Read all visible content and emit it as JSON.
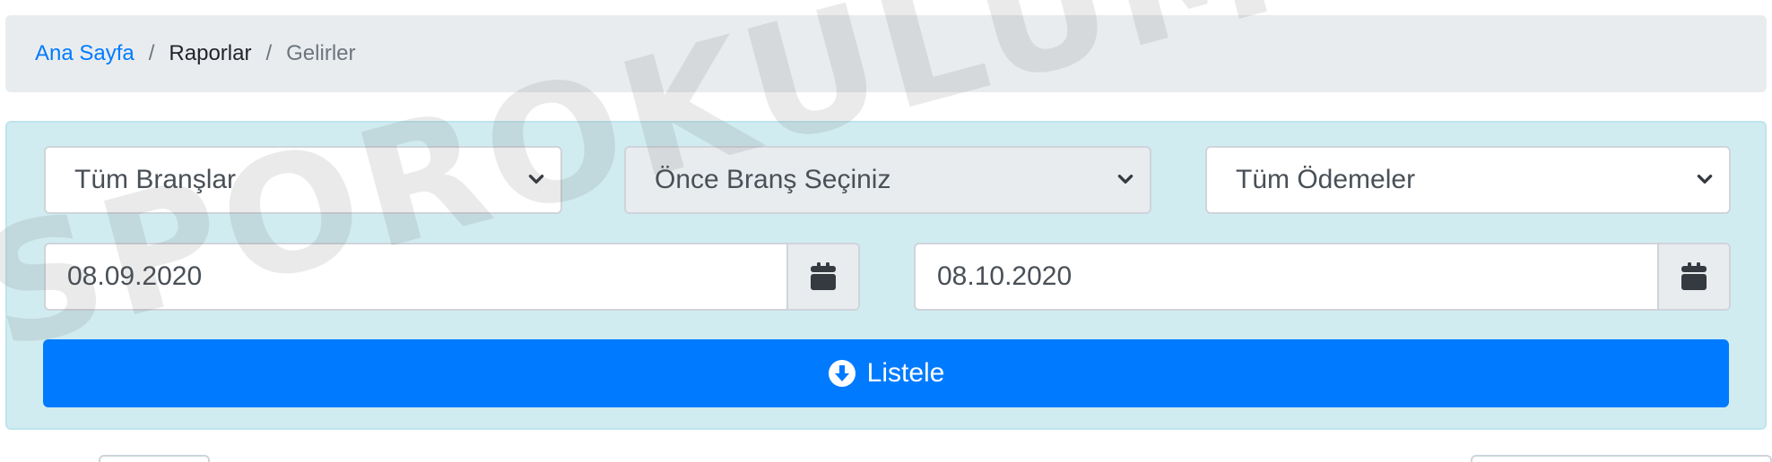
{
  "breadcrumb": {
    "home": "Ana Sayfa",
    "separator": "/",
    "reports": "Raporlar",
    "current": "Gelirler"
  },
  "filters": {
    "branch_select": "Tüm Branşlar",
    "group_select": "Önce Branş Seçiniz",
    "payment_select": "Tüm Ödemeler",
    "start_date": "08.09.2020",
    "end_date": "08.10.2020"
  },
  "actions": {
    "list_label": "Listele"
  },
  "watermark": "SPOROKULUMUZ.COM",
  "colors": {
    "primary": "#007bff",
    "panel_bg": "#d1ecf1",
    "breadcrumb_bg": "#e9ecef"
  },
  "icons": {
    "calendar": "calendar-icon",
    "chevron": "chevron-down-icon",
    "download": "arrow-circle-down-icon"
  }
}
